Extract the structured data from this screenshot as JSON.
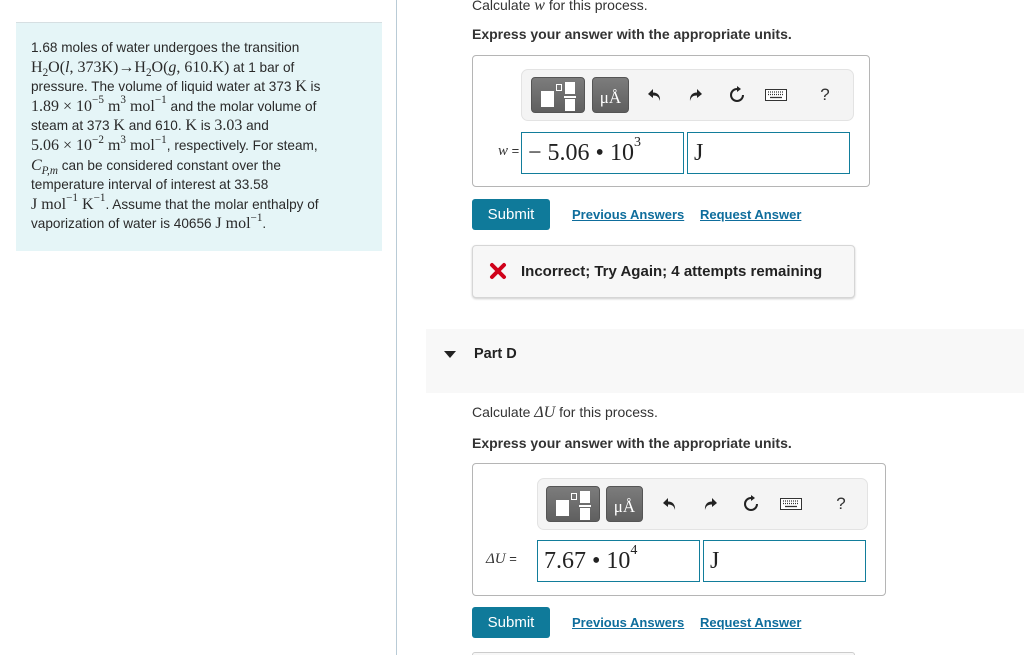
{
  "problem": {
    "line1": "1.68 moles of water undergoes the transition",
    "reaction": "H₂O(l, 373K)→H₂O(g, 610.K)",
    "reaction_suffix": " at 1 bar of",
    "line3_prefix": "pressure. The volume of liquid water at 373 ",
    "unit_K": "K",
    "line3_suffix": " is",
    "liquid_volume_mantissa": "1.89 × 10",
    "liquid_volume_exp": "−5",
    "unit_m": " m",
    "unit_m_exp": "3",
    "unit_mol": " mol",
    "unit_mol_exp": "−1",
    "line4_suffix": " and the molar volume of",
    "line5_prefix": "steam at 373 ",
    "line5_mid": " and 610. ",
    "line5_suffix_is": " is ",
    "steam_volume_1": "3.03",
    "line5_and": " and",
    "steam_volume_2_mantissa": "5.06  × 10",
    "steam_volume_2_exp": "−2",
    "line6_suffix": ", respectively. For steam,",
    "cp_symbol": "C",
    "cp_sub": "P,m",
    "line7_suffix": " can be considered constant over the",
    "line8": "temperature interval of interest at 33.58",
    "unit_J": "J",
    "unit_K_exp": "−1",
    "line9_suffix": ". Assume that the molar enthalpy of",
    "line10_prefix": "vaporization of water is 40656 ",
    "line10_end": "."
  },
  "part_c": {
    "question_prefix": "Calculate ",
    "question_var": "w",
    "question_suffix": " for this process.",
    "instruction": "Express your answer with the appropriate units.",
    "toolbar": {
      "units_label": "μÅ",
      "help_label": "?"
    },
    "var_label": "w",
    "equals": " =",
    "value_mantissa": "− 5.06 • 10",
    "value_exp": "3",
    "unit_value": "J",
    "submit_label": "Submit",
    "previous_answers_label": "Previous Answers",
    "request_answer_label": "Request Answer",
    "feedback": "Incorrect; Try Again; 4 attempts remaining"
  },
  "part_d": {
    "title": "Part D",
    "question_prefix": "Calculate ",
    "question_var": "ΔU",
    "question_suffix": " for this process.",
    "instruction": "Express your answer with the appropriate units.",
    "toolbar": {
      "units_label": "μÅ",
      "help_label": "?"
    },
    "var_label": "ΔU",
    "equals": " =",
    "value_mantissa": "7.67 • 10",
    "value_exp": "4",
    "unit_value": "J",
    "submit_label": "Submit",
    "previous_answers_label": "Previous Answers",
    "request_answer_label": "Request Answer"
  },
  "colors": {
    "accent": "#0f7a9a",
    "link": "#0e6d9c",
    "error": "#d0021b",
    "problem_bg": "#e5f5f7"
  }
}
